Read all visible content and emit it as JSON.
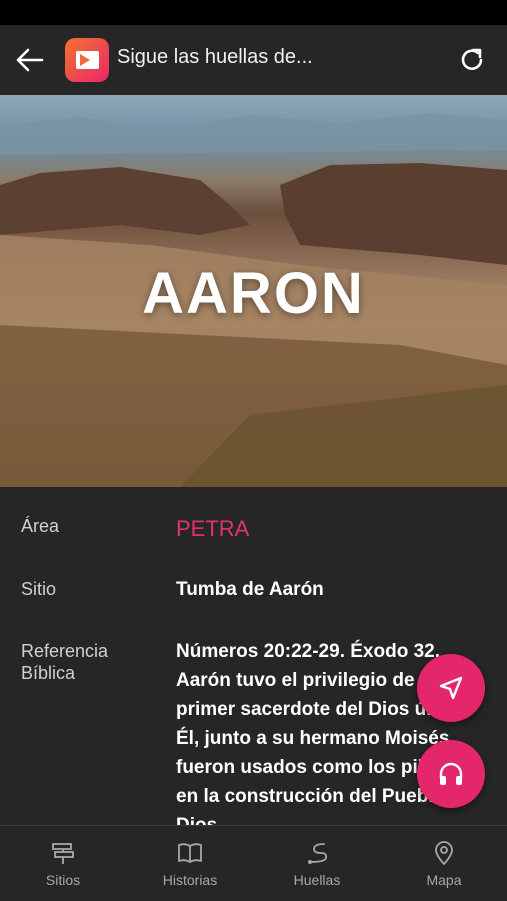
{
  "header": {
    "title": "Sigue las huellas de..."
  },
  "hero": {
    "title": "AARON"
  },
  "details": {
    "area_label": "Área",
    "area_value": "PETRA",
    "site_label": "Sitio",
    "site_value": "Tumba de Aarón",
    "ref_label_1": "Referencia",
    "ref_label_2": "Bíblica",
    "ref_text": "Números 20:22-29. Éxodo 32. Aarón tuvo el privilegio de ser el primer sacerdote del Dios único. Él, junto a su hermano Moisés, fueron usados como los pilares en la construcción del Pueblo de Dios."
  },
  "bottom_nav": [
    {
      "label": "Sitios",
      "icon": "signpost-icon"
    },
    {
      "label": "Historias",
      "icon": "book-icon"
    },
    {
      "label": "Huellas",
      "icon": "path-icon"
    },
    {
      "label": "Mapa",
      "icon": "map-pin-icon"
    }
  ],
  "colors": {
    "accent": "#e4266a",
    "background": "#262626"
  }
}
